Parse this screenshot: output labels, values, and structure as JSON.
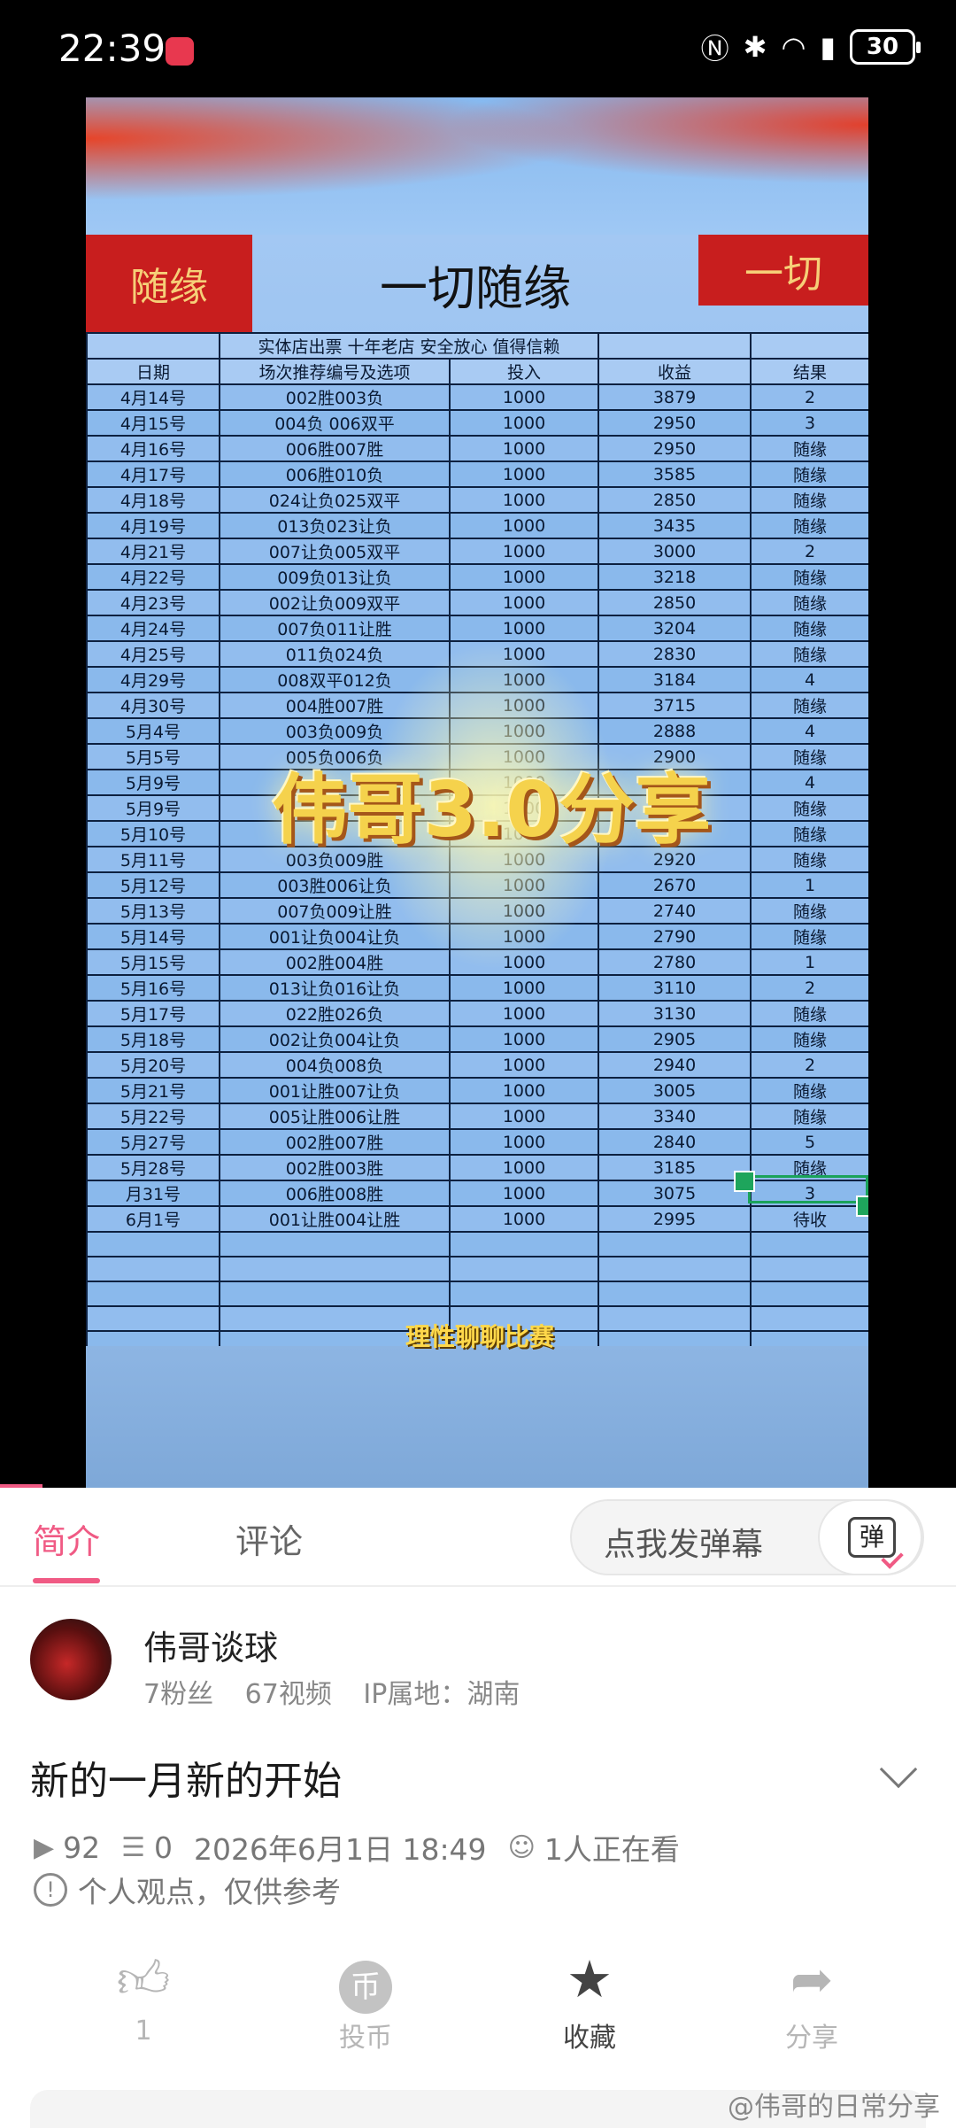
{
  "status_bar": {
    "time": "22:39",
    "battery": "30"
  },
  "video": {
    "title_cell": "一切随缘",
    "seal_left": "随缘",
    "seal_right": "一切",
    "subheader": "实体店出票   十年老店   安全放心   值得信赖",
    "columns": [
      "日期",
      "场次推荐编号及选项",
      "投入",
      "收益",
      "结果"
    ],
    "rows": [
      [
        "4月14号",
        "002胜003负",
        "1000",
        "3879",
        "2"
      ],
      [
        "4月15号",
        "004负 006双平",
        "1000",
        "2950",
        "3"
      ],
      [
        "4月16号",
        "006胜007胜",
        "1000",
        "2950",
        "随缘"
      ],
      [
        "4月17号",
        "006胜010负",
        "1000",
        "3585",
        "随缘"
      ],
      [
        "4月18号",
        "024让负025双平",
        "1000",
        "2850",
        "随缘"
      ],
      [
        "4月19号",
        "013负023让负",
        "1000",
        "3435",
        "随缘"
      ],
      [
        "4月21号",
        "007让负005双平",
        "1000",
        "3000",
        "2"
      ],
      [
        "4月22号",
        "009负013让负",
        "1000",
        "3218",
        "随缘"
      ],
      [
        "4月23号",
        "002让负009双平",
        "1000",
        "2850",
        "随缘"
      ],
      [
        "4月24号",
        "007负011让胜",
        "1000",
        "3204",
        "随缘"
      ],
      [
        "4月25号",
        "011负024负",
        "1000",
        "2830",
        "随缘"
      ],
      [
        "4月29号",
        "008双平012负",
        "1000",
        "3184",
        "4"
      ],
      [
        "4月30号",
        "004胜007胜",
        "1000",
        "3715",
        "随缘"
      ],
      [
        "5月4号",
        "003负009负",
        "1000",
        "2888",
        "4"
      ],
      [
        "5月5号",
        "005负006负",
        "1000",
        "2900",
        "随缘"
      ],
      [
        "5月9号",
        "",
        "1000",
        "",
        "4"
      ],
      [
        "5月9号",
        "",
        "1000",
        "",
        "随缘"
      ],
      [
        "5月10号",
        "",
        "1000",
        "",
        "随缘"
      ],
      [
        "5月11号",
        "003负009胜",
        "1000",
        "2920",
        "随缘"
      ],
      [
        "5月12号",
        "003胜006让负",
        "1000",
        "2670",
        "1"
      ],
      [
        "5月13号",
        "007负009让胜",
        "1000",
        "2740",
        "随缘"
      ],
      [
        "5月14号",
        "001让负004让负",
        "1000",
        "2790",
        "随缘"
      ],
      [
        "5月15号",
        "002胜004胜",
        "1000",
        "2780",
        "1"
      ],
      [
        "5月16号",
        "013让负016让负",
        "1000",
        "3110",
        "2"
      ],
      [
        "5月17号",
        "022胜026负",
        "1000",
        "3130",
        "随缘"
      ],
      [
        "5月18号",
        "002让负004让负",
        "1000",
        "2905",
        "随缘"
      ],
      [
        "5月20号",
        "004负008负",
        "1000",
        "2940",
        "2"
      ],
      [
        "5月21号",
        "001让胜007让负",
        "1000",
        "3005",
        "随缘"
      ],
      [
        "5月22号",
        "005让胜006让胜",
        "1000",
        "3340",
        "随缘"
      ],
      [
        "5月27号",
        "002胜007胜",
        "1000",
        "2840",
        "5"
      ],
      [
        "5月28号",
        "002胜003胜",
        "1000",
        "3185",
        "随缘"
      ],
      [
        "月31号",
        "006胜008胜",
        "1000",
        "3075",
        "3"
      ],
      [
        "6月1号",
        "001让胜004让胜",
        "1000",
        "2995",
        "待收"
      ]
    ],
    "overlay_title": "伟哥3.0分享",
    "caption": "理性聊聊比赛"
  },
  "tabs": {
    "intro": "简介",
    "comments": "评论",
    "danmaku_placeholder": "点我发弹幕",
    "danmaku_icon_text": "弹"
  },
  "uploader": {
    "name": "伟哥谈球",
    "followers": "7粉丝",
    "videos": "67视频",
    "ip": "IP属地：湖南"
  },
  "post": {
    "title": "新的一月新的开始",
    "plays": "92",
    "danmaku_count": "0",
    "datetime": "2026年6月1日 18:49",
    "watching": "1人正在看",
    "note": "个人观点，仅供参考"
  },
  "actions": {
    "like_count": "1",
    "coin": "投币",
    "coin_glyph": "币",
    "favorite": "收藏",
    "share": "分享"
  },
  "watermark": "@伟哥的日常分享"
}
